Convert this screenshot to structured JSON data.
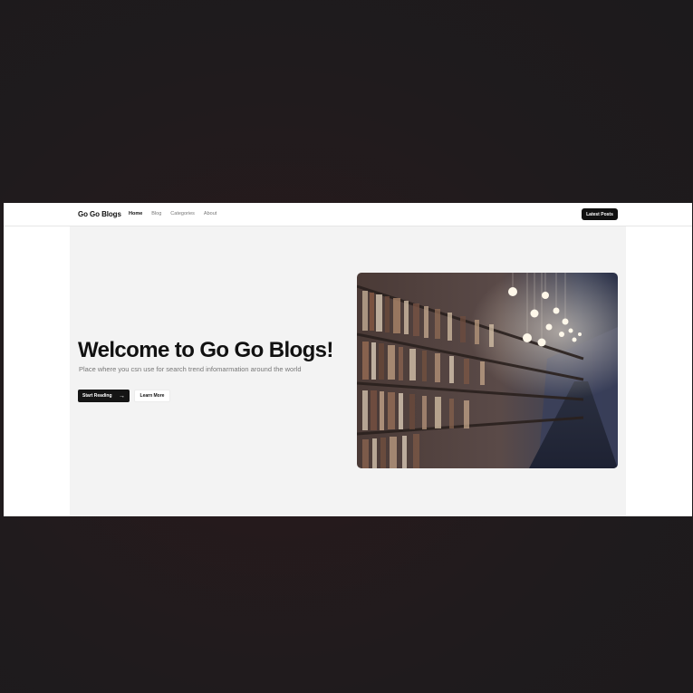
{
  "nav": {
    "brand": "Go Go Blogs",
    "links": [
      "Home",
      "Blog",
      "Categories",
      "About"
    ],
    "cta": "Latest Posts"
  },
  "hero": {
    "title": "Welcome to Go Go Blogs!",
    "subtitle": "Place where you csn use for search trend infomarmation around the world",
    "primary_button": "Start Reading",
    "primary_icon": "arrow-right-icon",
    "secondary_button": "Learn More",
    "image": "library-bookshelves-with-hanging-bulbs"
  },
  "colors": {
    "accent": "#111111",
    "hero_bg": "#f3f3f3",
    "page_bg": "#1f1b1d"
  }
}
